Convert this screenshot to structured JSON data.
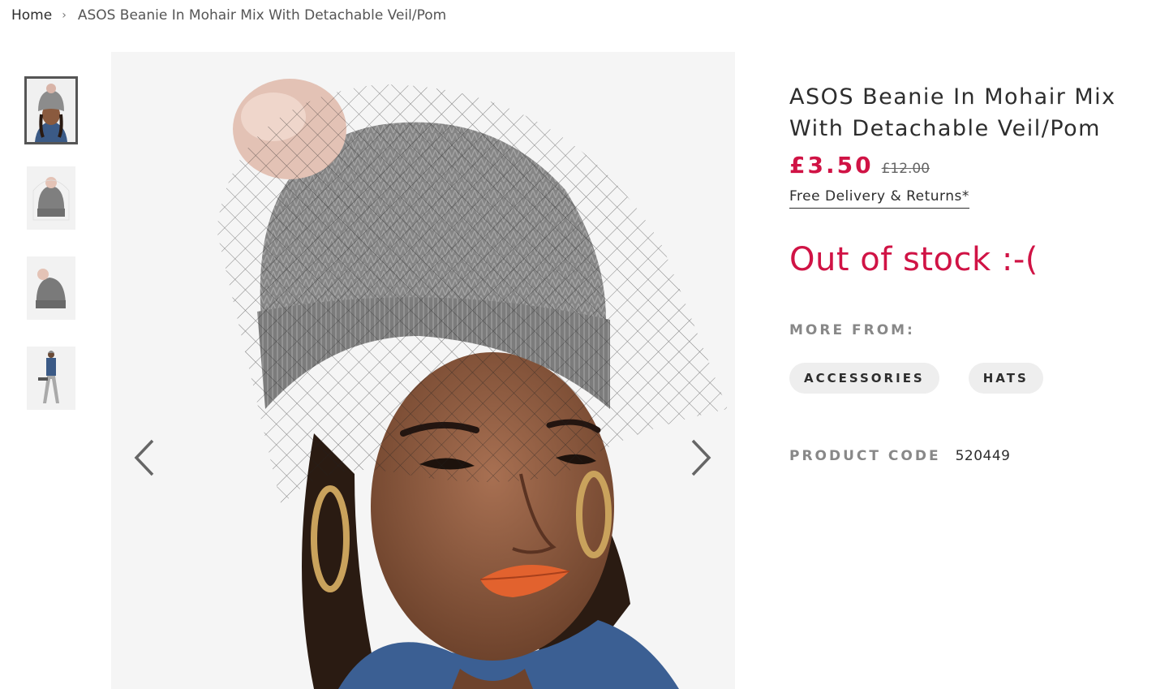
{
  "breadcrumb": {
    "home": "Home",
    "separator": "›",
    "current": "ASOS Beanie In Mohair Mix With Detachable Veil/Pom"
  },
  "gallery": {
    "thumbnails": [
      "thumbnail-model-closeup",
      "thumbnail-product-front",
      "thumbnail-product-side",
      "thumbnail-model-full"
    ],
    "active_index": 0,
    "prev_icon": "chevron-left-icon",
    "next_icon": "chevron-right-icon"
  },
  "product": {
    "title_line1": "ASOS Beanie In Mohair Mix",
    "title_line2": "With Detachable Veil/Pom",
    "price_now": "£3.50",
    "price_was": "£12.00",
    "delivery_link": "Free Delivery & Returns*",
    "stock_status": "Out of stock :-(",
    "more_from_label": "MORE FROM:",
    "tags": [
      "ACCESSORIES",
      "HATS"
    ],
    "code_label": "PRODUCT CODE",
    "code_value": "520449"
  },
  "colors": {
    "sale_red": "#d01345",
    "text_dark": "#2d2d2d",
    "muted_grey": "#888888",
    "tag_bg": "#eeeeee"
  }
}
